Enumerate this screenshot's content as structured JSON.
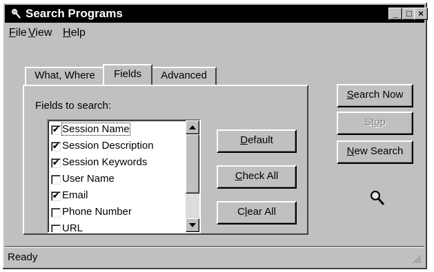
{
  "window": {
    "title": "Search Programs",
    "controls": {
      "minimize": "_",
      "maximize": "□",
      "close": "×"
    }
  },
  "menu": {
    "items": [
      {
        "label": "File",
        "accel": "F",
        "rest": "ile"
      },
      {
        "label": "View",
        "accel": "V",
        "rest": "iew"
      },
      {
        "label": "Help",
        "accel": "H",
        "rest": "elp"
      }
    ]
  },
  "tabs": [
    {
      "label": "What, Where",
      "active": false
    },
    {
      "label": "Fields",
      "active": true
    },
    {
      "label": "Advanced",
      "active": false
    }
  ],
  "fields_panel": {
    "heading": "Fields to search:",
    "list": [
      {
        "label": "Session Name",
        "checked": true,
        "focused": true
      },
      {
        "label": "Session Description",
        "checked": true
      },
      {
        "label": "Session Keywords",
        "checked": true
      },
      {
        "label": "User Name",
        "checked": false
      },
      {
        "label": "Email",
        "checked": true
      },
      {
        "label": "Phone Number",
        "checked": false
      },
      {
        "label": "URL",
        "checked": false
      }
    ],
    "buttons": {
      "default": {
        "label": "Default",
        "accel": "D",
        "rest": "efault"
      },
      "check_all": {
        "label": "Check All",
        "accel": "C",
        "rest": "heck All"
      },
      "clear_all": {
        "label": "Clear All",
        "pre": "C",
        "accel": "l",
        "rest": "ear All"
      }
    }
  },
  "side_buttons": {
    "search_now": {
      "label": "Search Now",
      "accel": "S",
      "rest": "earch Now"
    },
    "stop": {
      "label": "Stop",
      "pre": "St",
      "accel": "o",
      "rest": "p",
      "disabled": true
    },
    "new_search": {
      "label": "New Search",
      "accel": "N",
      "rest": "ew Search"
    }
  },
  "status": {
    "text": "Ready"
  },
  "icons": {
    "search": "magnifier-icon",
    "app": "search-app-icon",
    "grip": "size-grip-icon"
  }
}
